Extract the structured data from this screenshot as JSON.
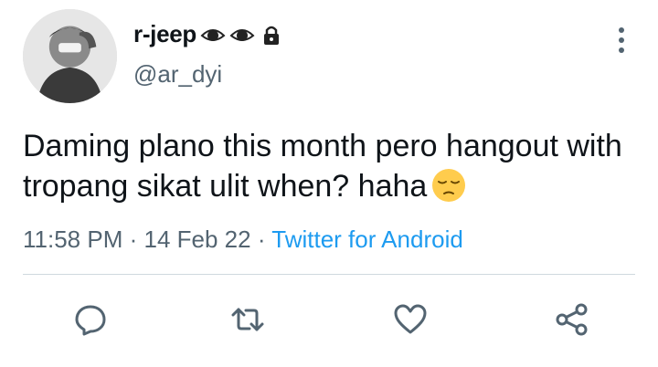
{
  "user": {
    "display_name": "r-jeep",
    "handle": "@ar_dyi",
    "name_emojis": [
      "eye-emoji",
      "eye-emoji",
      "lock-emoji"
    ]
  },
  "tweet": {
    "text": "Daming plano this month pero hangout with tropang sikat ulit when? haha",
    "emoji": "pensive-face-emoji"
  },
  "meta": {
    "time": "11:58 PM",
    "separator": "·",
    "date": "14 Feb 22",
    "source": "Twitter for Android"
  },
  "actions": {
    "icons": [
      "reply-icon",
      "retweet-icon",
      "like-icon",
      "share-icon"
    ]
  },
  "colors": {
    "text": "#0f1419",
    "secondary": "#536471",
    "link": "#1d9bf0",
    "divider": "#cfd9de"
  }
}
